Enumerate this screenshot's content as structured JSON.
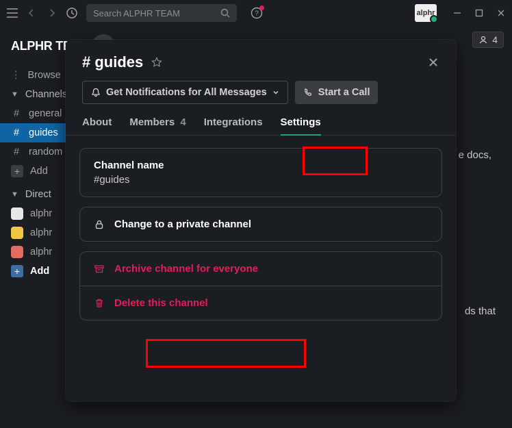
{
  "search": {
    "placeholder": "Search ALPHR TEAM"
  },
  "workspace": {
    "name": "ALPHR TE"
  },
  "sidebar": {
    "browse": "Browse",
    "channels_label": "Channels",
    "channels": [
      "general",
      "guides",
      "random"
    ],
    "add_channel": "Add",
    "dm_label": "Direct",
    "dms": [
      "alphr",
      "alphr",
      "alphr"
    ],
    "add_dm": "Add"
  },
  "header": {
    "members_count": "4"
  },
  "bg": {
    "docs": "e docs,",
    "that": "ds that"
  },
  "modal": {
    "title": "# guides",
    "notifications_btn": "Get Notifications for All Messages",
    "start_call": "Start a Call",
    "tabs": {
      "about": "About",
      "members": "Members",
      "members_count": "4",
      "integrations": "Integrations",
      "settings": "Settings"
    },
    "channel_name_label": "Channel name",
    "channel_name_value": "#guides",
    "change_private": "Change to a private channel",
    "archive": "Archive channel for everyone",
    "delete": "Delete this channel"
  }
}
